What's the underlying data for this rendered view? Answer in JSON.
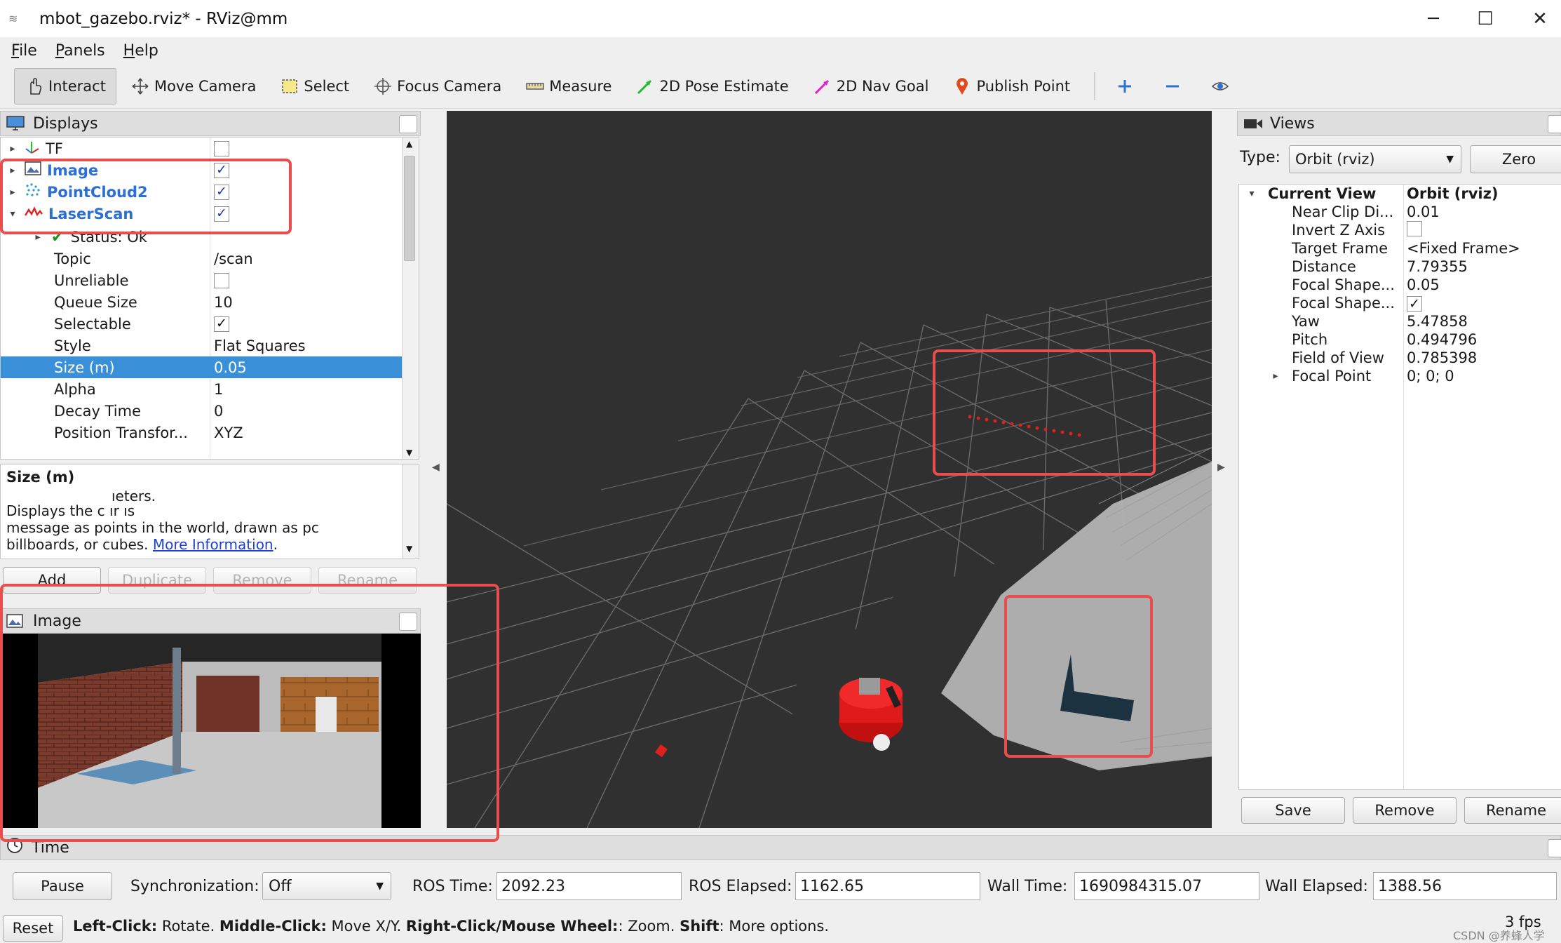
{
  "window": {
    "title": "mbot_gazebo.rviz* - RViz@mm",
    "minimize": "─",
    "maximize": "☐",
    "close": "✕"
  },
  "menu": [
    "File",
    "Panels",
    "Help"
  ],
  "toolbar": {
    "interact": "Interact",
    "move_camera": "Move Camera",
    "select": "Select",
    "focus_camera": "Focus Camera",
    "measure": "Measure",
    "pose_estimate": "2D Pose Estimate",
    "nav_goal": "2D Nav Goal",
    "publish_point": "Publish Point"
  },
  "displays": {
    "title": "Displays",
    "items": [
      {
        "name": "TF",
        "checked": false
      },
      {
        "name": "Image",
        "checked": true
      },
      {
        "name": "PointCloud2",
        "checked": true
      },
      {
        "name": "LaserScan",
        "checked": true
      }
    ],
    "laserscan_props": [
      {
        "name": "Status: Ok",
        "value": ""
      },
      {
        "name": "Topic",
        "value": "/scan"
      },
      {
        "name": "Unreliable",
        "value": ""
      },
      {
        "name": "Queue Size",
        "value": "10"
      },
      {
        "name": "Selectable",
        "value": ""
      },
      {
        "name": "Style",
        "value": "Flat Squares"
      },
      {
        "name": "Size (m)",
        "value": "0.05"
      },
      {
        "name": "Alpha",
        "value": "1"
      },
      {
        "name": "Decay Time",
        "value": "0"
      },
      {
        "name": "Position Transfor...",
        "value": "XYZ"
      }
    ],
    "check_mark": "✓"
  },
  "description": {
    "title": "Size (m)",
    "line1": "ıeters.",
    "line2": "Displays the c                   ır                   ıs",
    "line3": "message as points in the world, drawn as pc",
    "line4": "billboards, or cubes.",
    "link": "More Information",
    "period": "."
  },
  "display_buttons": {
    "add": "Add",
    "duplicate": "Duplicate",
    "remove": "Remove",
    "rename": "Rename"
  },
  "image_panel": {
    "title": "Image"
  },
  "views": {
    "title": "Views",
    "type_label": "Type:",
    "type_value": "Orbit (rviz)",
    "zero": "Zero",
    "current_view": "Current View",
    "current_view_value": "Orbit (rviz)",
    "props": [
      {
        "name": "Near Clip Di...",
        "value": "0.01"
      },
      {
        "name": "Invert Z Axis",
        "value": ""
      },
      {
        "name": "Target Frame",
        "value": "<Fixed Frame>"
      },
      {
        "name": "Distance",
        "value": "7.79355"
      },
      {
        "name": "Focal Shape...",
        "value": "0.05"
      },
      {
        "name": "Focal Shape...",
        "value": ""
      },
      {
        "name": "Yaw",
        "value": "5.47858"
      },
      {
        "name": "Pitch",
        "value": "0.494796"
      },
      {
        "name": "Field of View",
        "value": "0.785398"
      },
      {
        "name": "Focal Point",
        "value": "0; 0; 0"
      }
    ],
    "save": "Save",
    "remove": "Remove",
    "rename": "Rename"
  },
  "time": {
    "title": "Time",
    "pause": "Pause",
    "sync_label": "Synchronization:",
    "sync_value": "Off",
    "ros_time_label": "ROS Time:",
    "ros_time": "2092.23",
    "ros_elapsed_label": "ROS Elapsed:",
    "ros_elapsed": "1162.65",
    "wall_time_label": "Wall Time:",
    "wall_time": "1690984315.07",
    "wall_elapsed_label": "Wall Elapsed:",
    "wall_elapsed": "1388.56"
  },
  "status": {
    "reset": "Reset",
    "left_click": "Left-Click:",
    "rotate": " Rotate. ",
    "middle_click": "Middle-Click:",
    "move_xy": " Move X/Y. ",
    "right_click": "Right-Click/Mouse Wheel:",
    "zoom": ": Zoom. ",
    "shift": "Shift",
    "more": ": More options.",
    "fps": "3 fps",
    "watermark": "CSDN @养蜂人学"
  },
  "colors": {
    "accent": "#3a8fd9",
    "highlight_box": "#ea4d4d",
    "viewport_bg": "#303030",
    "laser_red": "#e0201c"
  }
}
